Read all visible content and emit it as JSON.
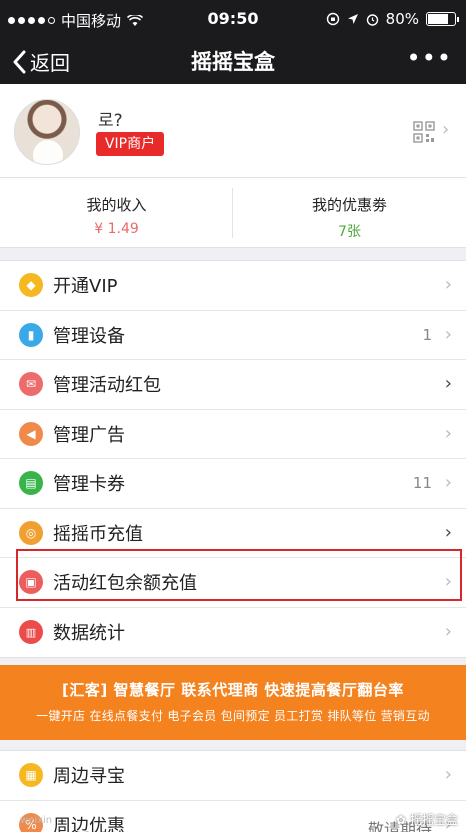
{
  "status_bar": {
    "carrier": "中国移动",
    "time": "09:50",
    "battery": "80%",
    "battery_level": 0.8
  },
  "nav": {
    "back_label": "返回",
    "title": "摇摇宝盒",
    "more_label": "•••"
  },
  "profile": {
    "name": "로?",
    "badge": "VIP商户"
  },
  "stats": {
    "income_label": "我的收入",
    "income_value": "¥ 1.49",
    "coupon_label": "我的优惠劵",
    "coupon_value": "7张"
  },
  "menu": [
    {
      "label": "开通VIP",
      "count": "",
      "icon": "diamond-icon",
      "color": "#f5b820"
    },
    {
      "label": "管理设备",
      "count": "1",
      "icon": "device-icon",
      "color": "#3aa9e8"
    },
    {
      "label": "管理活动红包",
      "count": "",
      "icon": "red-packet-icon",
      "color": "#ee6b6b"
    },
    {
      "label": "管理广告",
      "count": "",
      "icon": "megaphone-icon",
      "color": "#f08a4b"
    },
    {
      "label": "管理卡券",
      "count": "11",
      "icon": "ticket-icon",
      "color": "#39b44a"
    },
    {
      "label": "摇摇币充值",
      "count": "",
      "icon": "coin-icon",
      "color": "#f0a030"
    },
    {
      "label": "活动红包余额充值",
      "count": "",
      "icon": "gift-icon",
      "color": "#ec5d5d"
    },
    {
      "label": "数据统计",
      "count": "",
      "icon": "chart-icon",
      "color": "#ec4b4b"
    }
  ],
  "banner": {
    "line1": "[汇客] 智慧餐厅 联系代理商 快速提高餐厅翻台率",
    "line2": "一键开店 在线点餐支付 电子会员 包间预定 员工打赏 排队等位 营销互动"
  },
  "menu2": [
    {
      "label": "周边寻宝",
      "right": "",
      "icon": "treasure-icon",
      "color": "#f5b820"
    },
    {
      "label": "周边优惠",
      "right": "敬请期待",
      "icon": "discount-icon",
      "color": "#f08a4b"
    }
  ],
  "watermark": "摇摇宝盒",
  "watermark_small": "weixin"
}
